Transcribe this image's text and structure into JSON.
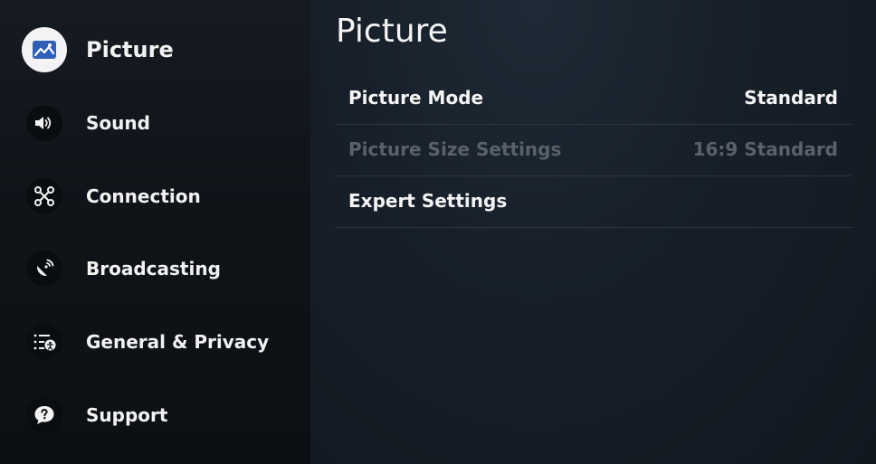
{
  "sidebar": {
    "items": [
      {
        "label": "Picture",
        "icon": "picture-icon",
        "active": true
      },
      {
        "label": "Sound",
        "icon": "speaker-icon"
      },
      {
        "label": "Connection",
        "icon": "network-icon"
      },
      {
        "label": "Broadcasting",
        "icon": "satellite-dish-icon"
      },
      {
        "label": "General & Privacy",
        "icon": "general-settings-icon"
      },
      {
        "label": "Support",
        "icon": "support-chat-icon"
      }
    ]
  },
  "main": {
    "title": "Picture",
    "rows": [
      {
        "label": "Picture Mode",
        "value": "Standard",
        "enabled": true
      },
      {
        "label": "Picture Size Settings",
        "value": "16:9 Standard",
        "enabled": false
      },
      {
        "label": "Expert Settings",
        "value": "",
        "enabled": true
      }
    ]
  },
  "colors": {
    "active_icon_bg": "#f3f3f5",
    "active_icon_accent": "#2f5fb8",
    "text": "#f4f4f4",
    "disabled_text": "#59616b",
    "divider": "#2d3540"
  }
}
